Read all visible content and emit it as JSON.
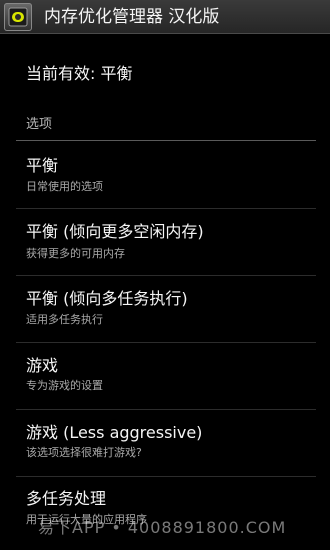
{
  "app": {
    "title": "内存优化管理器 汉化版",
    "icon": "memory-chip-icon"
  },
  "status": {
    "current": "当前有效: 平衡"
  },
  "section": {
    "header": "选项"
  },
  "options": [
    {
      "title": "平衡",
      "subtitle": "日常使用的选项"
    },
    {
      "title": "平衡 (倾向更多空闲内存)",
      "subtitle": "获得更多的可用内存"
    },
    {
      "title": "平衡 (倾向多任务执行)",
      "subtitle": "适用多任务执行"
    },
    {
      "title": "游戏",
      "subtitle": "专为游戏的设置"
    },
    {
      "title": "游戏 (Less aggressive)",
      "subtitle": "该选项选择很难打游戏?"
    },
    {
      "title": "多任务处理",
      "subtitle": "用于运行大量的应用程序"
    }
  ],
  "watermark": {
    "text": "易下APP • 4008891800.COM"
  },
  "colors": {
    "background": "#000000",
    "titlebar": "#2e2e2e",
    "icon_accent": "#d8e600"
  }
}
